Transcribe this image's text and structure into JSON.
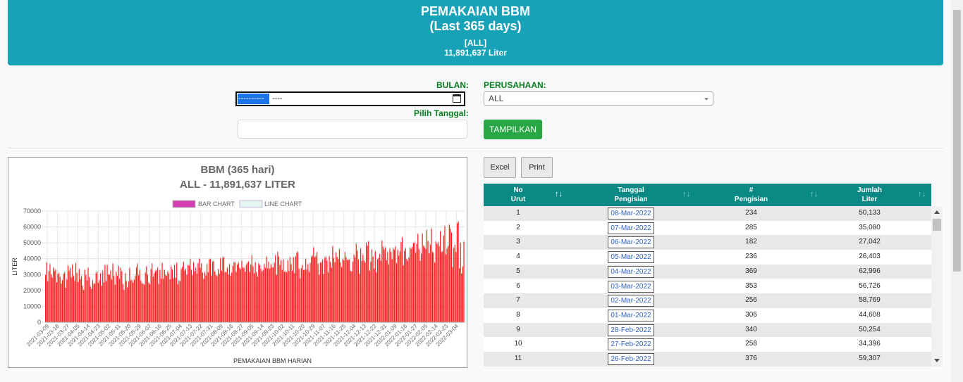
{
  "header": {
    "title": "PEMAKAIAN BBM",
    "subtitle": "(Last 365 days)",
    "filter": "[ALL]",
    "total": "11,891,637 Liter"
  },
  "form": {
    "bulan_label": "BULAN:",
    "bulan_value": "---------- ----",
    "tanggal_label": "Pilih Tanggal:",
    "tanggal_value": "",
    "perusahaan_label": "PERUSAHAAN:",
    "perusahaan_value": "ALL",
    "submit_label": "TAMPILKAN"
  },
  "actions": {
    "excel": "Excel",
    "print": "Print"
  },
  "colors": {
    "header_bg": "#17a2b8",
    "table_header": "#0b8a85",
    "bar": "#ff1a1a",
    "button": "#28a745"
  },
  "chart_data": {
    "type": "bar",
    "title": "BBM (365 hari)",
    "subtitle": "ALL - 11,891,637 LITER",
    "legend": [
      "BAR CHART",
      "LINE CHART"
    ],
    "legend_position": "top",
    "xlabel": "PEMAKAIAN BBM HARIAN",
    "ylabel": "LITER",
    "ylim": [
      0,
      70000
    ],
    "yticks": [
      0,
      10000,
      20000,
      30000,
      40000,
      50000,
      60000,
      70000
    ],
    "xticks": [
      "2021-03-09",
      "2021-03-18",
      "2021-03-27",
      "2021-04-05",
      "2021-04-14",
      "2021-04-23",
      "2021-05-02",
      "2021-05-11",
      "2021-05-20",
      "2021-05-29",
      "2021-06-07",
      "2021-06-16",
      "2021-06-25",
      "2021-07-04",
      "2021-07-13",
      "2021-07-22",
      "2021-07-31",
      "2021-08-09",
      "2021-08-18",
      "2021-08-27",
      "2021-09-05",
      "2021-09-14",
      "2021-09-23",
      "2021-10-02",
      "2021-10-11",
      "2021-10-20",
      "2021-10-29",
      "2021-11-07",
      "2021-11-16",
      "2021-11-25",
      "2021-12-04",
      "2021-12-13",
      "2021-12-22",
      "2021-12-31",
      "2022-01-09",
      "2022-01-18",
      "2022-01-27",
      "2022-02-05",
      "2022-02-14",
      "2022-02-23",
      "2022-03-04"
    ],
    "grid": true,
    "values": [
      30100,
      38000,
      26200,
      32500,
      36800,
      30500,
      28400,
      34600,
      32700,
      33500,
      25400,
      30700,
      31300,
      29000,
      24700,
      26800,
      30600,
      31800,
      22100,
      27300,
      36000,
      32700,
      34400,
      28600,
      36600,
      29500,
      26400,
      37600,
      31500,
      25700,
      33900,
      27400,
      29300,
      23200,
      20700,
      33300,
      30100,
      26700,
      34600,
      28700,
      22800,
      21300,
      26700,
      24700,
      24700,
      31200,
      32300,
      25300,
      26700,
      31100,
      23300,
      32800,
      25500,
      36300,
      26300,
      36300,
      30500,
      30200,
      32800,
      27300,
      37200,
      29600,
      24100,
      32100,
      29500,
      35800,
      27700,
      34500,
      32500,
      24400,
      20700,
      31200,
      26300,
      22300,
      26000,
      34500,
      26800,
      26900,
      25400,
      27100,
      29600,
      34800,
      37100,
      30000,
      33000,
      26500,
      24900,
      24600,
      24000,
      31600,
      35500,
      30300,
      25300,
      24400,
      33700,
      37300,
      29100,
      31200,
      32700,
      33000,
      34700,
      24600,
      33300,
      27800,
      37600,
      27800,
      33300,
      30300,
      29600,
      32300,
      31000,
      27400,
      35500,
      33600,
      27900,
      36500,
      28400,
      37700,
      24300,
      26500,
      26300,
      33900,
      35200,
      38300,
      32900,
      33800,
      30200,
      36400,
      36000,
      40300,
      33400,
      30000,
      38100,
      32500,
      34600,
      31000,
      37500,
      40400,
      34700,
      37300,
      31600,
      27600,
      31800,
      29900,
      36900,
      31800,
      40100,
      40200,
      29600,
      38500,
      38900,
      32400,
      30100,
      29400,
      33700,
      30800,
      40700,
      32800,
      40900,
      41300,
      32000,
      31900,
      34600,
      30300,
      36900,
      29600,
      31600,
      35900,
      38100,
      38100,
      32000,
      36600,
      37900,
      34600,
      33700,
      39100,
      34800,
      34600,
      32200,
      36500,
      37700,
      38600,
      32000,
      36700,
      42600,
      35500,
      31200,
      38100,
      32100,
      29200,
      37300,
      36400,
      34000,
      32400,
      33200,
      36900,
      34600,
      41500,
      34300,
      38400,
      34200,
      36800,
      34900,
      34900,
      37800,
      42600,
      30200,
      44500,
      41700,
      36400,
      39500,
      33400,
      39800,
      32100,
      32300,
      31900,
      39300,
      32700,
      41300,
      36800,
      32800,
      41200,
      31300,
      41800,
      44000,
      44700,
      34000,
      28200,
      34300,
      36400,
      33200,
      33400,
      40400,
      33500,
      36800,
      32000,
      37600,
      41500,
      42300,
      47500,
      41300,
      41800,
      44300,
      37100,
      30400,
      37900,
      38000,
      39800,
      30700,
      40900,
      41700,
      39100,
      31700,
      41800,
      38300,
      34700,
      48100,
      40700,
      38100,
      44200,
      41500,
      40200,
      46400,
      38000,
      35000,
      40100,
      39400,
      44400,
      41200,
      39600,
      39800,
      39800,
      32800,
      32300,
      38500,
      42900,
      41200,
      49900,
      45400,
      39800,
      30800,
      46800,
      38900,
      42800,
      39300,
      37900,
      50400,
      48500,
      51300,
      32900,
      38500,
      46100,
      41800,
      34300,
      45000,
      31700,
      40000,
      40800,
      43400,
      39100,
      51600,
      47800,
      46200,
      47500,
      39400,
      44600,
      36700,
      46800,
      44600,
      40100,
      46800,
      46000,
      48000,
      37600,
      45900,
      42300,
      45000,
      50800,
      53900,
      36200,
      45200,
      47000,
      40200,
      39100,
      41000,
      47400,
      46600,
      47800,
      50300,
      50500,
      44100,
      49700,
      55900,
      46400,
      39100,
      43600,
      56100,
      48500,
      47600,
      46500,
      58300,
      51500,
      43800,
      49300,
      59300,
      44600,
      44100,
      38000,
      51200,
      49700,
      50700,
      48100,
      57700,
      44500,
      45000,
      54800,
      60700,
      43200,
      46800,
      48400,
      61800,
      59300,
      56900,
      35000,
      47200,
      49100,
      44600,
      62700,
      63700,
      34200,
      50400,
      31000,
      35400,
      51000
    ]
  },
  "table": {
    "headers": [
      {
        "l1": "No",
        "l2": "Urut"
      },
      {
        "l1": "Tanggal",
        "l2": "Pengisian"
      },
      {
        "l1": "#",
        "l2": "Pengisian"
      },
      {
        "l1": "Jumlah",
        "l2": "Liter"
      }
    ],
    "rows": [
      {
        "no": "1",
        "tanggal": "08-Mar-2022",
        "pengisian": "234",
        "liter": "50,133"
      },
      {
        "no": "2",
        "tanggal": "07-Mar-2022",
        "pengisian": "285",
        "liter": "35,080"
      },
      {
        "no": "3",
        "tanggal": "06-Mar-2022",
        "pengisian": "182",
        "liter": "27,042"
      },
      {
        "no": "4",
        "tanggal": "05-Mar-2022",
        "pengisian": "236",
        "liter": "26,403"
      },
      {
        "no": "5",
        "tanggal": "04-Mar-2022",
        "pengisian": "369",
        "liter": "62,996"
      },
      {
        "no": "6",
        "tanggal": "03-Mar-2022",
        "pengisian": "353",
        "liter": "56,726"
      },
      {
        "no": "7",
        "tanggal": "02-Mar-2022",
        "pengisian": "256",
        "liter": "58,769"
      },
      {
        "no": "8",
        "tanggal": "01-Mar-2022",
        "pengisian": "306",
        "liter": "44,608"
      },
      {
        "no": "9",
        "tanggal": "28-Feb-2022",
        "pengisian": "340",
        "liter": "50,254"
      },
      {
        "no": "10",
        "tanggal": "27-Feb-2022",
        "pengisian": "258",
        "liter": "34,396"
      },
      {
        "no": "11",
        "tanggal": "26-Feb-2022",
        "pengisian": "376",
        "liter": "59,307"
      }
    ]
  }
}
